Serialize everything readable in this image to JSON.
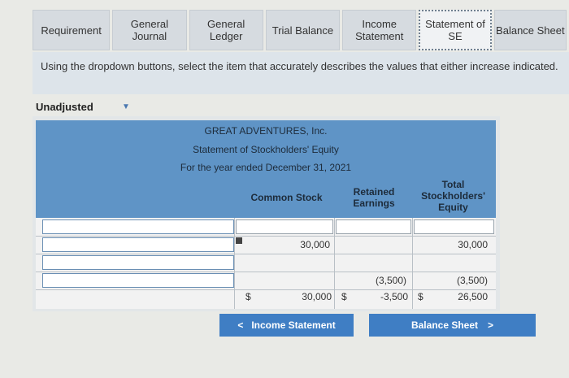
{
  "tabs": [
    {
      "label": "Requirement"
    },
    {
      "label": "General\nJournal"
    },
    {
      "label": "General\nLedger"
    },
    {
      "label": "Trial Balance"
    },
    {
      "label": "Income\nStatement"
    },
    {
      "label": "Statement of\nSE"
    },
    {
      "label": "Balance Sheet"
    }
  ],
  "instructions": "Using the dropdown buttons, select the item that accurately describes the values that either increase indicated.",
  "mode_select": {
    "value": "Unadjusted"
  },
  "statement": {
    "company": "GREAT ADVENTURES, Inc.",
    "title": "Statement of Stockholders' Equity",
    "period": "For the year ended December 31, 2021",
    "columns": {
      "common_stock": "Common Stock",
      "retained_earnings": "Retained\nEarnings",
      "total_equity": "Total\nStockholders'\nEquity"
    },
    "rows": [
      {
        "cs": "",
        "re": "",
        "total": ""
      },
      {
        "cs": "30,000",
        "re": "",
        "total": "30,000"
      },
      {
        "cs": "",
        "re": "",
        "total": ""
      },
      {
        "cs": "",
        "re": "(3,500)",
        "total": "(3,500)"
      },
      {
        "dollar1": "$",
        "cs": "30,000",
        "dollar2": "$",
        "re": "-3,500",
        "dollar3": "$",
        "total": "26,500"
      }
    ]
  },
  "nav": {
    "prev_label": "Income Statement",
    "next_label": "Balance Sheet"
  }
}
